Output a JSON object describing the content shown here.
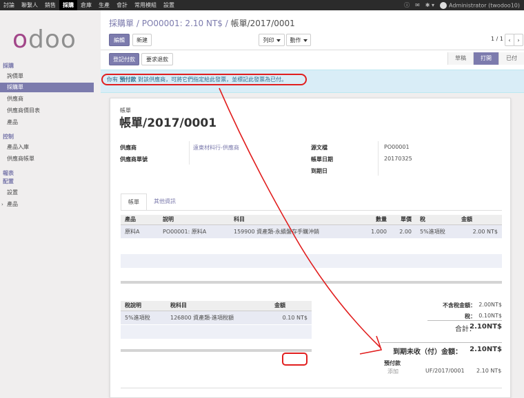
{
  "topbar": {
    "menu": [
      "討論",
      "聯繫人",
      "銷售",
      "採購",
      "倉庫",
      "生產",
      "會計",
      "常用模組",
      "設置"
    ],
    "active_menu": "採購",
    "user": "Administrator (twodoo10)"
  },
  "sidebar": {
    "logo": "odoo",
    "sections": [
      {
        "title": "採購",
        "items": [
          "詢價單",
          "採購單",
          "供應商",
          "供應商價目表",
          "產品"
        ]
      },
      {
        "title": "控制",
        "items": [
          "產品入庫",
          "供應商帳單"
        ]
      },
      {
        "title": "報表",
        "items": []
      },
      {
        "title": "配置",
        "items": [
          "設置",
          "產品"
        ]
      }
    ],
    "active_item": "採購單"
  },
  "breadcrumb": {
    "part1": "採購單",
    "part2": "PO00001: 2.10 NT$",
    "current": "帳單/2017/0001",
    "sep": "/"
  },
  "toolbar": {
    "edit": "編輯",
    "create": "新建",
    "print": "列印",
    "action": "動作",
    "pager": "1 / 1",
    "prev": "‹",
    "next": "›"
  },
  "actions": {
    "register_payment": "登記付款",
    "ask_refund": "要求退款"
  },
  "stages": [
    "草稿",
    "打開",
    "已付"
  ],
  "active_stage": "打開",
  "alert": {
    "prefix": "你有",
    "bold": "預付款",
    "suffix": "對該供應商，可將它們指定給此發票，並標記此發票為已付。"
  },
  "sheet": {
    "type_label": "帳單",
    "title": "帳單/2017/0001",
    "fields_left": [
      {
        "label": "供應商",
        "value": "遠東材料行-供應商"
      },
      {
        "label": "供應商單號",
        "value": ""
      }
    ],
    "fields_right": [
      {
        "label": "源文檔",
        "value": "PO00001"
      },
      {
        "label": "帳單日期",
        "value": "20170325"
      },
      {
        "label": "到期日",
        "value": ""
      }
    ],
    "tabs": [
      "帳單",
      "其他資訊"
    ],
    "lines_headers": [
      "產品",
      "說明",
      "科目",
      "數量",
      "單價",
      "稅",
      "金額"
    ],
    "lines": [
      {
        "product": "原料A",
        "desc": "PO00001: 原料A",
        "account": "159900 資產類-永續盤存手購沖銷",
        "qty": "1.000",
        "price": "2.00",
        "tax": "5%進項稅",
        "amount": "2.00 NT$"
      }
    ],
    "tax_headers": [
      "稅說明",
      "稅科目",
      "金額"
    ],
    "tax_lines": [
      {
        "desc": "5%進項稅",
        "account": "126800 資產類-進項稅額",
        "amount": "0.10 NT$"
      }
    ],
    "totals": {
      "untaxed_label": "不含稅金額：",
      "untaxed": "2.00NT$",
      "tax_label": "稅：",
      "tax": "0.10NT$",
      "total_label": "合計：",
      "total": "2.10NT$",
      "due_label": "到期未收（付）金額：",
      "due": "2.10NT$"
    },
    "outstanding": {
      "label": "預付款",
      "add_button": "添加",
      "ref": "UF/2017/0001",
      "amount": "2.10 NT$"
    }
  },
  "colors": {
    "brand": "#7c7bad",
    "annotation": "#e11d1d"
  }
}
